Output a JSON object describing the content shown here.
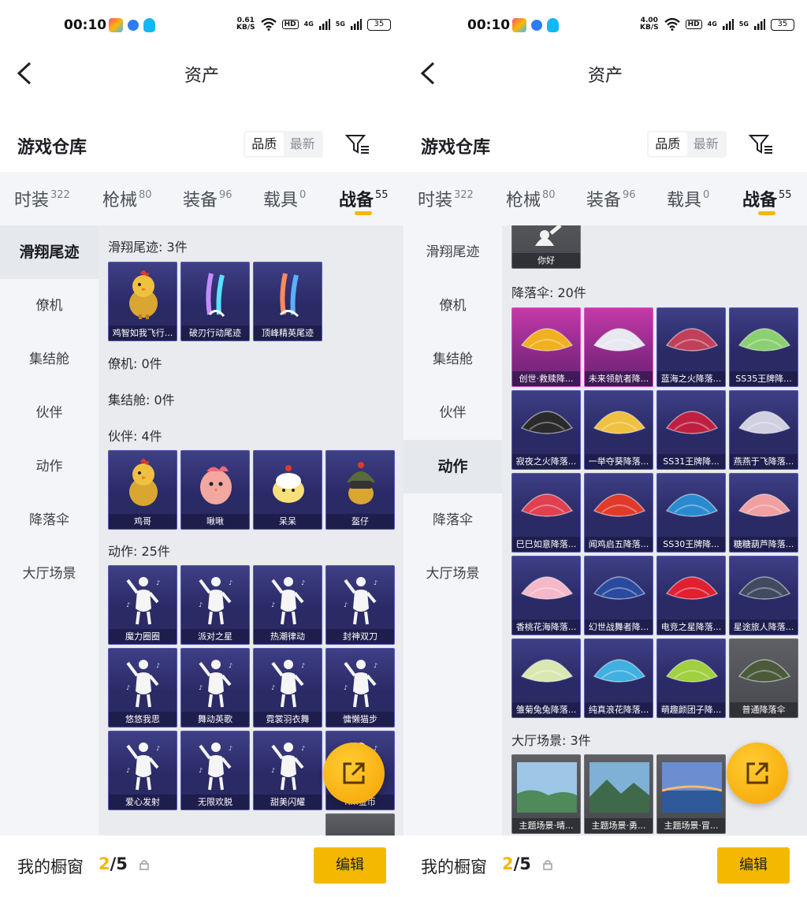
{
  "panels": [
    {
      "status": {
        "time": "00:10",
        "speed": "0.61",
        "speed_unit": "KB/S",
        "hd": "HD",
        "sig1": "4G",
        "sig2": "5G",
        "battery": "35"
      },
      "header": {
        "title": "资产"
      },
      "warehouse": {
        "title": "游戏仓库",
        "sort_quality": "品质",
        "sort_newest": "最新"
      },
      "tabs": [
        {
          "label": "时装",
          "count": "322"
        },
        {
          "label": "枪械",
          "count": "80"
        },
        {
          "label": "装备",
          "count": "96"
        },
        {
          "label": "载具",
          "count": "0"
        },
        {
          "label": "战备",
          "count": "55"
        }
      ],
      "sidebar": [
        "滑翔尾迹",
        "僚机",
        "集结舱",
        "伙伴",
        "动作",
        "降落伞",
        "大厅场景"
      ],
      "sections": {
        "s1": "滑翔尾迹: 3件",
        "s2": "僚机: 0件",
        "s3": "集结舱: 0件",
        "s4": "伙伴: 4件",
        "s5": "动作: 25件"
      },
      "trail_items": [
        "鸡智如我飞行...",
        "破刃行动尾迹",
        "顶峰精英尾迹"
      ],
      "partner_items": [
        "鸡哥",
        "啾啾",
        "呆呆",
        "盔仔"
      ],
      "action_items": [
        "魔力圈圈",
        "派对之星",
        "热潮律动",
        "封神双刀",
        "悠悠我思",
        "舞动英歌",
        "霓裳羽衣舞",
        "慵懒猫步",
        "爱心发射",
        "无限欢脱",
        "甜美闪耀",
        "K...金币"
      ],
      "bottom": {
        "title": "我的橱窗",
        "current": "2",
        "sep_total": "/5",
        "edit": "编辑"
      }
    },
    {
      "status": {
        "time": "00:10",
        "speed": "4.00",
        "speed_unit": "KB/S",
        "hd": "HD",
        "sig1": "4G",
        "sig2": "5G",
        "battery": "35"
      },
      "header": {
        "title": "资产"
      },
      "warehouse": {
        "title": "游戏仓库",
        "sort_quality": "品质",
        "sort_newest": "最新"
      },
      "tabs": [
        {
          "label": "时装",
          "count": "322"
        },
        {
          "label": "枪械",
          "count": "80"
        },
        {
          "label": "装备",
          "count": "96"
        },
        {
          "label": "载具",
          "count": "0"
        },
        {
          "label": "战备",
          "count": "55"
        }
      ],
      "sidebar": [
        "滑翔尾迹",
        "僚机",
        "集结舱",
        "伙伴",
        "动作",
        "降落伞",
        "大厅场景"
      ],
      "sections": {
        "top_item": "你好",
        "s1": "降落伞: 20件",
        "s2": "大厅场景: 3件"
      },
      "parachutes": [
        "创世·救赎降...",
        "未来领航者降...",
        "蓝海之火降落...",
        "SS35王牌降...",
        "寂夜之火降落...",
        "一举夺葵降落...",
        "SS31王牌降...",
        "燕燕于飞降落...",
        "巳巳如意降落...",
        "闻鸡启五降落...",
        "SS30王牌降...",
        "糖糖葫芦降落...",
        "香桃花海降落...",
        "幻世战舞者降...",
        "电竞之星降落...",
        "星途旅人降落...",
        "雏菊兔兔降落...",
        "纯真浪花降落...",
        "萌趣颜团子降...",
        "普通降落伞"
      ],
      "scenes": [
        "主题场景·晴...",
        "主题场景·勇...",
        "主题场景·冒..."
      ],
      "bottom": {
        "title": "我的橱窗",
        "current": "2",
        "sep_total": "/5",
        "edit": "编辑"
      }
    }
  ]
}
